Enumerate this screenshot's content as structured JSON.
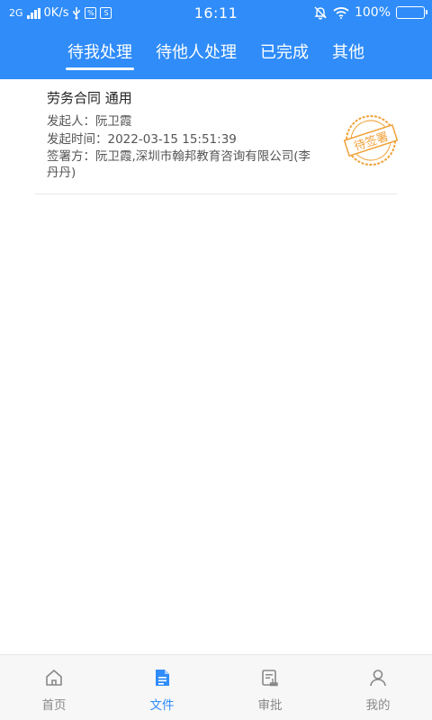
{
  "status_bar": {
    "network": "2G",
    "speed": "0K/s",
    "time": "16:11",
    "battery": "100%",
    "battery_level": 1.0
  },
  "tabs": [
    {
      "label": "待我处理",
      "active": true
    },
    {
      "label": "待他人处理",
      "active": false
    },
    {
      "label": "已完成",
      "active": false
    },
    {
      "label": "其他",
      "active": false
    }
  ],
  "documents": [
    {
      "title": "劳务合同 通用",
      "initiator": "发起人：阮卫霞",
      "initiated_time": "发起时间：2022-03-15 15:51:39",
      "signers": "签署方：阮卫霞,深圳市翰邦教育咨询有限公司(李丹丹)",
      "stamp": "待签署"
    }
  ],
  "bottom_nav": [
    {
      "label": "首页",
      "icon": "home-icon",
      "active": false
    },
    {
      "label": "文件",
      "icon": "document-icon",
      "active": true
    },
    {
      "label": "审批",
      "icon": "approval-icon",
      "active": false
    },
    {
      "label": "我的",
      "icon": "profile-icon",
      "active": false
    }
  ],
  "colors": {
    "primary": "#2f8cf9",
    "stamp": "#f0a23a",
    "nav_inactive": "#888888"
  }
}
